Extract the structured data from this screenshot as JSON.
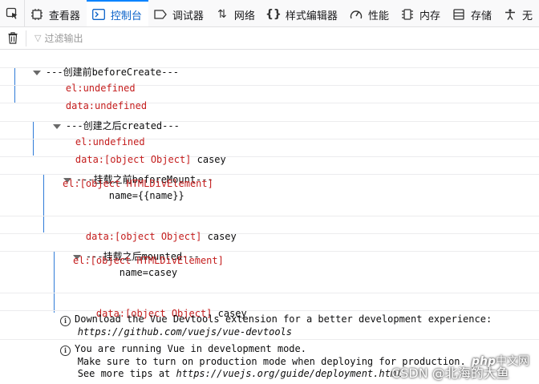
{
  "toolbar": {
    "tabs": [
      {
        "label": "查看器",
        "icon": "inspector-icon"
      },
      {
        "label": "控制台",
        "icon": "console-icon"
      },
      {
        "label": "调试器",
        "icon": "debugger-icon"
      },
      {
        "label": "网络",
        "icon": "network-icon"
      },
      {
        "label": "样式编辑器",
        "icon": "style-editor-icon"
      },
      {
        "label": "性能",
        "icon": "performance-icon"
      },
      {
        "label": "内存",
        "icon": "memory-icon"
      },
      {
        "label": "存储",
        "icon": "storage-icon"
      },
      {
        "label": "无",
        "icon": "accessibility-icon"
      }
    ],
    "active_tab": "控制台"
  },
  "filter": {
    "placeholder": "过滤输出"
  },
  "console": {
    "g1_header": "---创建前beforeCreate---",
    "g1_el": "el:undefined",
    "g1_data": "data:undefined",
    "g2_header": "---创建之后created---",
    "g2_el": "el:undefined",
    "g2_data_label": "data:[object Object]",
    "g2_data_value": " casey",
    "g3_header": "---挂载之前beforeMount---",
    "g3_el": "el:[object HTMLDivElement]",
    "g3_el_value": "        name={{name}}",
    "g3_data_label": "data:[object Object]",
    "g3_data_value": " casey",
    "g4_header": "---挂载之后mounted---",
    "g4_el": "el:[object HTMLDivElement]",
    "g4_el_value": "        name=casey",
    "g4_data_label": "data:[object Object]",
    "g4_data_value": " casey",
    "msg1_line1": "Download the Vue Devtools extension for a better development experience:",
    "msg1_url": "https://github.com/vuejs/vue-devtools",
    "msg2_line1": "You are running Vue in development mode.",
    "msg2_line2": "Make sure to turn on production mode when deploying for production.",
    "msg2_line3_prefix": "See more tips at ",
    "msg2_url": "https://vuejs.org/guide/deployment.html"
  },
  "watermark": {
    "text": "CSDN @北海的大鱼",
    "logo": "php",
    "logo_suffix": "中文网"
  }
}
